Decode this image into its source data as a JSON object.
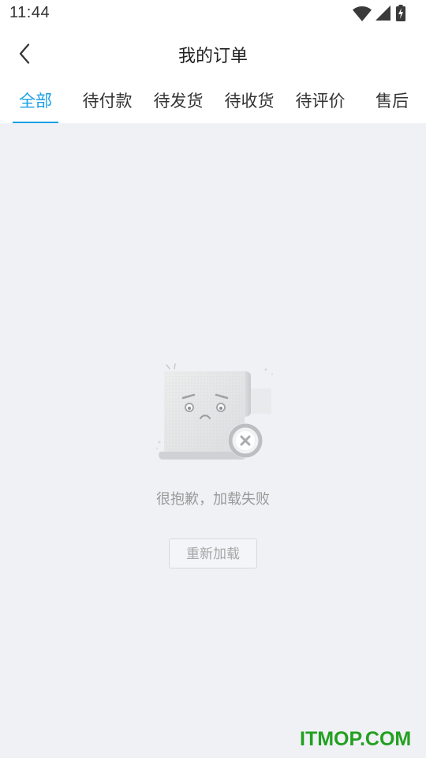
{
  "status_bar": {
    "time": "11:44",
    "icons": [
      "wifi-icon",
      "cell-signal-icon",
      "battery-charging-icon"
    ]
  },
  "header": {
    "title": "我的订单",
    "back_icon": "chevron-left-icon"
  },
  "tabs": [
    {
      "label": "全部",
      "active": true
    },
    {
      "label": "待付款",
      "active": false
    },
    {
      "label": "待发货",
      "active": false
    },
    {
      "label": "待收货",
      "active": false
    },
    {
      "label": "待评价",
      "active": false
    },
    {
      "label": "售后",
      "active": false
    }
  ],
  "empty_state": {
    "illustration": "sad-document-error-icon",
    "message": "很抱歉，加载失败",
    "reload_label": "重新加载"
  },
  "watermark": "ITMOP.COM",
  "colors": {
    "accent": "#1aa0e6",
    "background": "#f0f1f5",
    "watermark": "#22a020"
  }
}
